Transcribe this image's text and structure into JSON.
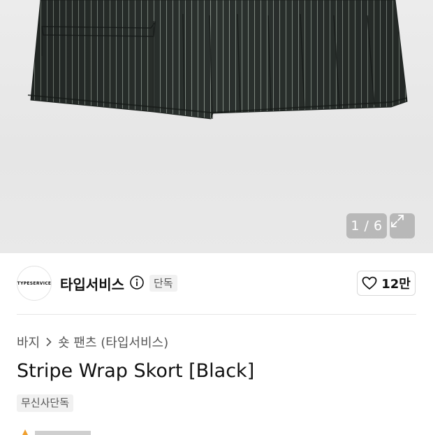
{
  "gallery": {
    "counter": "1 / 6",
    "product_image": "striped wrap skort photo"
  },
  "brand": {
    "logo_text": "TYPESERVICE",
    "name": "타입서비스",
    "exclusive_badge": "단독"
  },
  "like": {
    "icon": "heart-icon",
    "count": "12만"
  },
  "breadcrumb": {
    "category": "바지",
    "subcategory": "숏 팬츠 (타입서비스)"
  },
  "product": {
    "title": "Stripe Wrap Skort [Black]",
    "tag": "무신사단독"
  },
  "colors": {
    "fabric": "#2b312e",
    "stripe": "#9aa39c",
    "badge_bg": "#f1f1f1"
  }
}
